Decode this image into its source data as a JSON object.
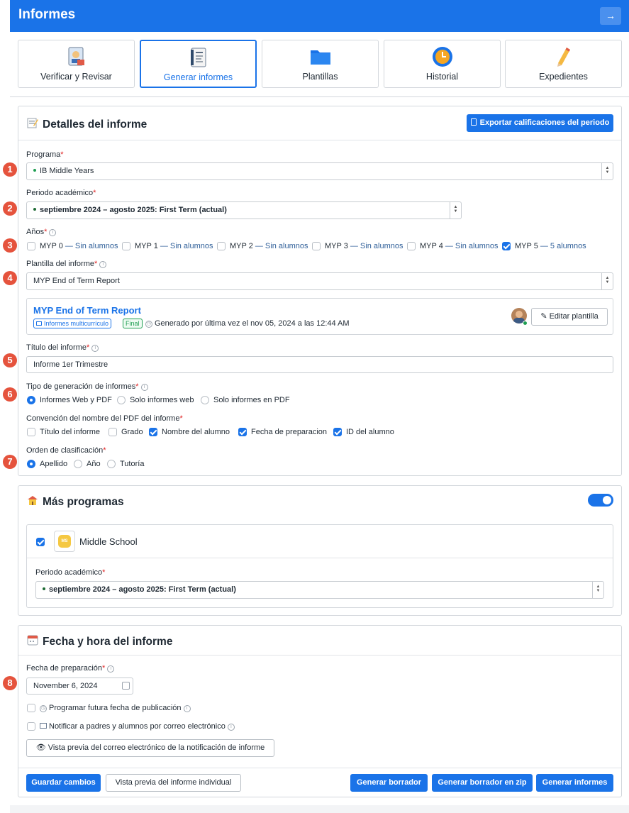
{
  "app": {
    "title": "Informes",
    "header_button_icon": "arrow-right-icon"
  },
  "tabs": [
    {
      "label": "Verificar y Revisar",
      "icon": "inspect-report-icon"
    },
    {
      "label": "Generar informes",
      "icon": "report-notebook-icon",
      "active": true
    },
    {
      "label": "Plantillas",
      "icon": "folder-icon"
    },
    {
      "label": "Historial",
      "icon": "clock-icon"
    },
    {
      "label": "Expedientes",
      "icon": "pencil-icon"
    }
  ],
  "details": {
    "title": "Detalles del informe",
    "export_button": "Exportar calificaciones del periodo",
    "programa_label": "Programa",
    "programa_value": "IB Middle Years",
    "periodo_label": "Periodo académico",
    "periodo_value": "septiembre 2024 – agosto 2025: First Term (actual)",
    "anios_label": "Años",
    "years": [
      {
        "name": "MYP 0",
        "count": "— Sin alumnos",
        "checked": false
      },
      {
        "name": "MYP 1",
        "count": "— Sin alumnos",
        "checked": false
      },
      {
        "name": "MYP 2",
        "count": "— Sin alumnos",
        "checked": false
      },
      {
        "name": "MYP 3",
        "count": "— Sin alumnos",
        "checked": false
      },
      {
        "name": "MYP 4",
        "count": "— Sin alumnos",
        "checked": false
      },
      {
        "name": "MYP 5",
        "count": "— 5 alumnos",
        "checked": true
      }
    ],
    "plantilla_label": "Plantilla del informe",
    "plantilla_value": "MYP End of Term Report",
    "template_card": {
      "name": "MYP End of Term Report",
      "chip_multi": "Informes multicurrículo",
      "chip_final": "Final",
      "generated": "Generado por última vez el nov 05, 2024 a las 12:44 AM",
      "edit_button": "Editar plantilla"
    },
    "titulo_label": "Título del informe",
    "titulo_value": "Informe 1er Trimestre",
    "tipo_label": "Tipo de generación de informes",
    "tipo_options": [
      {
        "label": "Informes Web y PDF",
        "selected": true
      },
      {
        "label": "Solo informes web",
        "selected": false
      },
      {
        "label": "Solo informes en PDF",
        "selected": false
      }
    ],
    "convencion_label": "Convención del nombre del PDF del informe",
    "convencion_options": [
      {
        "label": "Título del informe",
        "checked": false
      },
      {
        "label": "Grado",
        "checked": false
      },
      {
        "label": "Nombre del alumno",
        "checked": true
      },
      {
        "label": "Fecha de preparacion",
        "checked": true
      },
      {
        "label": "ID del alumno",
        "checked": true
      }
    ],
    "orden_label": "Orden de clasificación",
    "orden_options": [
      {
        "label": "Apellido",
        "selected": true
      },
      {
        "label": "Año",
        "selected": false
      },
      {
        "label": "Tutoría",
        "selected": false
      }
    ]
  },
  "more_programs": {
    "title": "Más programas",
    "toggle_on": true,
    "program_name": "Middle School",
    "program_logo_text": "MS",
    "periodo_label": "Periodo académico",
    "periodo_value": "septiembre 2024 – agosto 2025: First Term (actual)"
  },
  "date_section": {
    "title": "Fecha y hora del informe",
    "fecha_label": "Fecha de preparación",
    "fecha_value": "November 6, 2024",
    "schedule_label": "Programar futura fecha de publicación",
    "notify_label": "Notificar a padres y alumnos por correo electrónico",
    "preview_email_button": "Vista previa del correo electrónico de la notificación de informe"
  },
  "footer": {
    "save": "Guardar cambios",
    "preview_individual": "Vista previa del informe individual",
    "draft": "Generar borrador",
    "draft_zip": "Generar borrador en zip",
    "generate": "Generar informes"
  },
  "step_badges": [
    "1",
    "2",
    "3",
    "4",
    "5",
    "6",
    "7",
    "8"
  ],
  "colors": {
    "primary": "#1a73e8",
    "badge": "#e5533d",
    "success": "#1e9e52"
  }
}
